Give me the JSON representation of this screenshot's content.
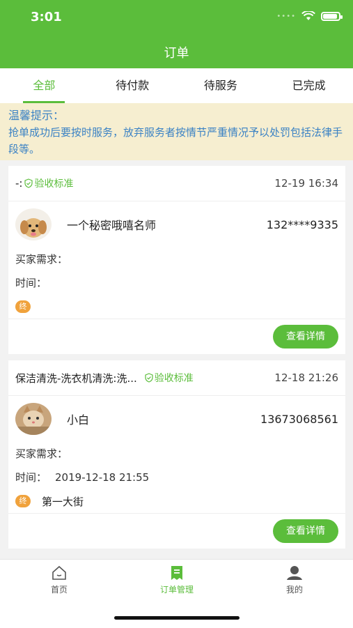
{
  "status_bar": {
    "time": "3:01"
  },
  "nav": {
    "title": "订单"
  },
  "tabs": [
    {
      "label": "全部",
      "active": true
    },
    {
      "label": "待付款"
    },
    {
      "label": "待服务"
    },
    {
      "label": "已完成"
    }
  ],
  "notice": {
    "title": "温馨提示：",
    "body": "抢单成功后要按时服务，放弃服务者按情节严重情况予以处罚包括法律手段等。"
  },
  "orders": [
    {
      "service": "-:",
      "standard": "验收标准",
      "date": "12-19 16:34",
      "user": "一个秘密哦嘻名师",
      "phone": "132****9335",
      "demand_label": "买家需求：",
      "demand": "",
      "time_label": "时间：",
      "time": "",
      "end_badge": "终",
      "address": "",
      "detail_button": "查看详情",
      "avatar_icon": "dog-avatar"
    },
    {
      "service": "保洁清洗-洗衣机清洗:洗...",
      "standard": "验收标准",
      "date": "12-18 21:26",
      "user": "小白",
      "phone": "13673068561",
      "demand_label": "买家需求：",
      "demand": "",
      "time_label": "时间：",
      "time": "2019-12-18 21:55",
      "end_badge": "终",
      "address": "第一大街",
      "detail_button": "查看详情",
      "avatar_icon": "cat-avatar"
    }
  ],
  "tabbar": [
    {
      "label": "首页",
      "icon": "home-icon"
    },
    {
      "label": "订单管理",
      "icon": "order-icon",
      "active": true
    },
    {
      "label": "我的",
      "icon": "profile-icon"
    }
  ],
  "colors": {
    "primary": "#5bbd3b",
    "notice_bg": "#f6eed0",
    "notice_text": "#3b82c4",
    "badge": "#f0a23c"
  }
}
